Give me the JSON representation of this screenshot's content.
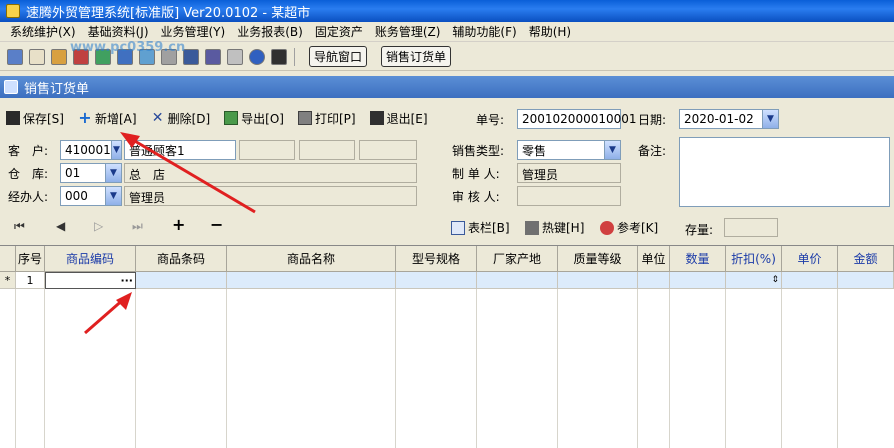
{
  "window": {
    "title": "速腾外贸管理系统[标准版] Ver20.0102 - 某超市"
  },
  "menu": [
    "系统维护(X)",
    "基础资料(J)",
    "业务管理(Y)",
    "业务报表(B)",
    "固定资产",
    "账务管理(Z)",
    "辅助功能(F)",
    "帮助(H)"
  ],
  "toolbar": {
    "nav_window": "导航窗口",
    "sales_order": "销售订货单"
  },
  "document": {
    "title": "销售订货单"
  },
  "actions": {
    "save": "保存[S]",
    "add": "新增[A]",
    "delete": "删除[D]",
    "export": "导出[O]",
    "print": "打印[P]",
    "exit": "退出[E]",
    "columns": "表栏[B]",
    "hotkey": "热键[H]",
    "reference": "参考[K]"
  },
  "header": {
    "order_no_label": "单号:",
    "order_no": "200102000010001",
    "date_label": "日期:",
    "date": "2020-01-02",
    "customer_label": "客　户:",
    "customer_code": "410001",
    "customer_name": "普通顾客1",
    "warehouse_label": "仓　库:",
    "warehouse_code": "01",
    "warehouse_name": "总　店",
    "handler_label": "经办人:",
    "handler_code": "000",
    "handler_name": "管理员",
    "sale_type_label": "销售类型:",
    "sale_type": "零售",
    "maker_label": "制 单 人:",
    "maker": "管理员",
    "auditor_label": "审 核 人:",
    "auditor": "",
    "remark_label": "备注:"
  },
  "nav": {
    "first": "⏮",
    "prev": "◀",
    "next": "▷",
    "last": "⏭",
    "plus": "+",
    "minus": "−"
  },
  "stock_label": "存量:",
  "grid": {
    "columns": [
      "序号",
      "商品编码",
      "商品条码",
      "商品名称",
      "型号规格",
      "厂家产地",
      "质量等级",
      "单位",
      "数量",
      "折扣(%)",
      "单价",
      "金额"
    ],
    "row1_marker": "*",
    "row1_no": "1",
    "ellipsis": "···"
  },
  "watermark": "www.pc0359.cn"
}
